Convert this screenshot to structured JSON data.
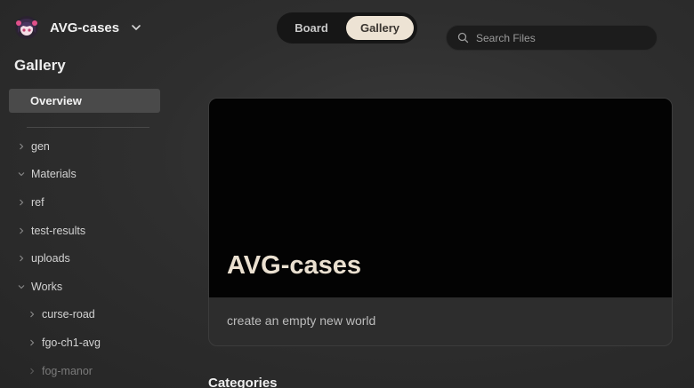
{
  "workspace": {
    "name": "AVG-cases",
    "logo_icon": "anime-avatar-icon",
    "dropdown_icon": "chevron-down-icon"
  },
  "sidebar": {
    "title": "Gallery",
    "overview_label": "Overview",
    "tree": [
      {
        "label": "gen",
        "expanded": false
      },
      {
        "label": "Materials",
        "expanded": true
      },
      {
        "label": "ref",
        "expanded": false
      },
      {
        "label": "test-results",
        "expanded": false
      },
      {
        "label": "uploads",
        "expanded": false
      },
      {
        "label": "Works",
        "expanded": true
      },
      {
        "label": "curse-road",
        "expanded": false
      },
      {
        "label": "fgo-ch1-avg",
        "expanded": false
      },
      {
        "label": "fog-manor",
        "expanded": false
      }
    ]
  },
  "view_switch": {
    "board_label": "Board",
    "gallery_label": "Gallery",
    "active": "Gallery"
  },
  "search": {
    "placeholder": "Search Files",
    "value": ""
  },
  "hero": {
    "title": "AVG-cases",
    "description": "create an empty new world"
  },
  "sections": {
    "categories_label": "Categories"
  },
  "colors": {
    "accent": "#ede3d4",
    "hero_title": "#eae0d0",
    "background": "#2e2e2e"
  }
}
